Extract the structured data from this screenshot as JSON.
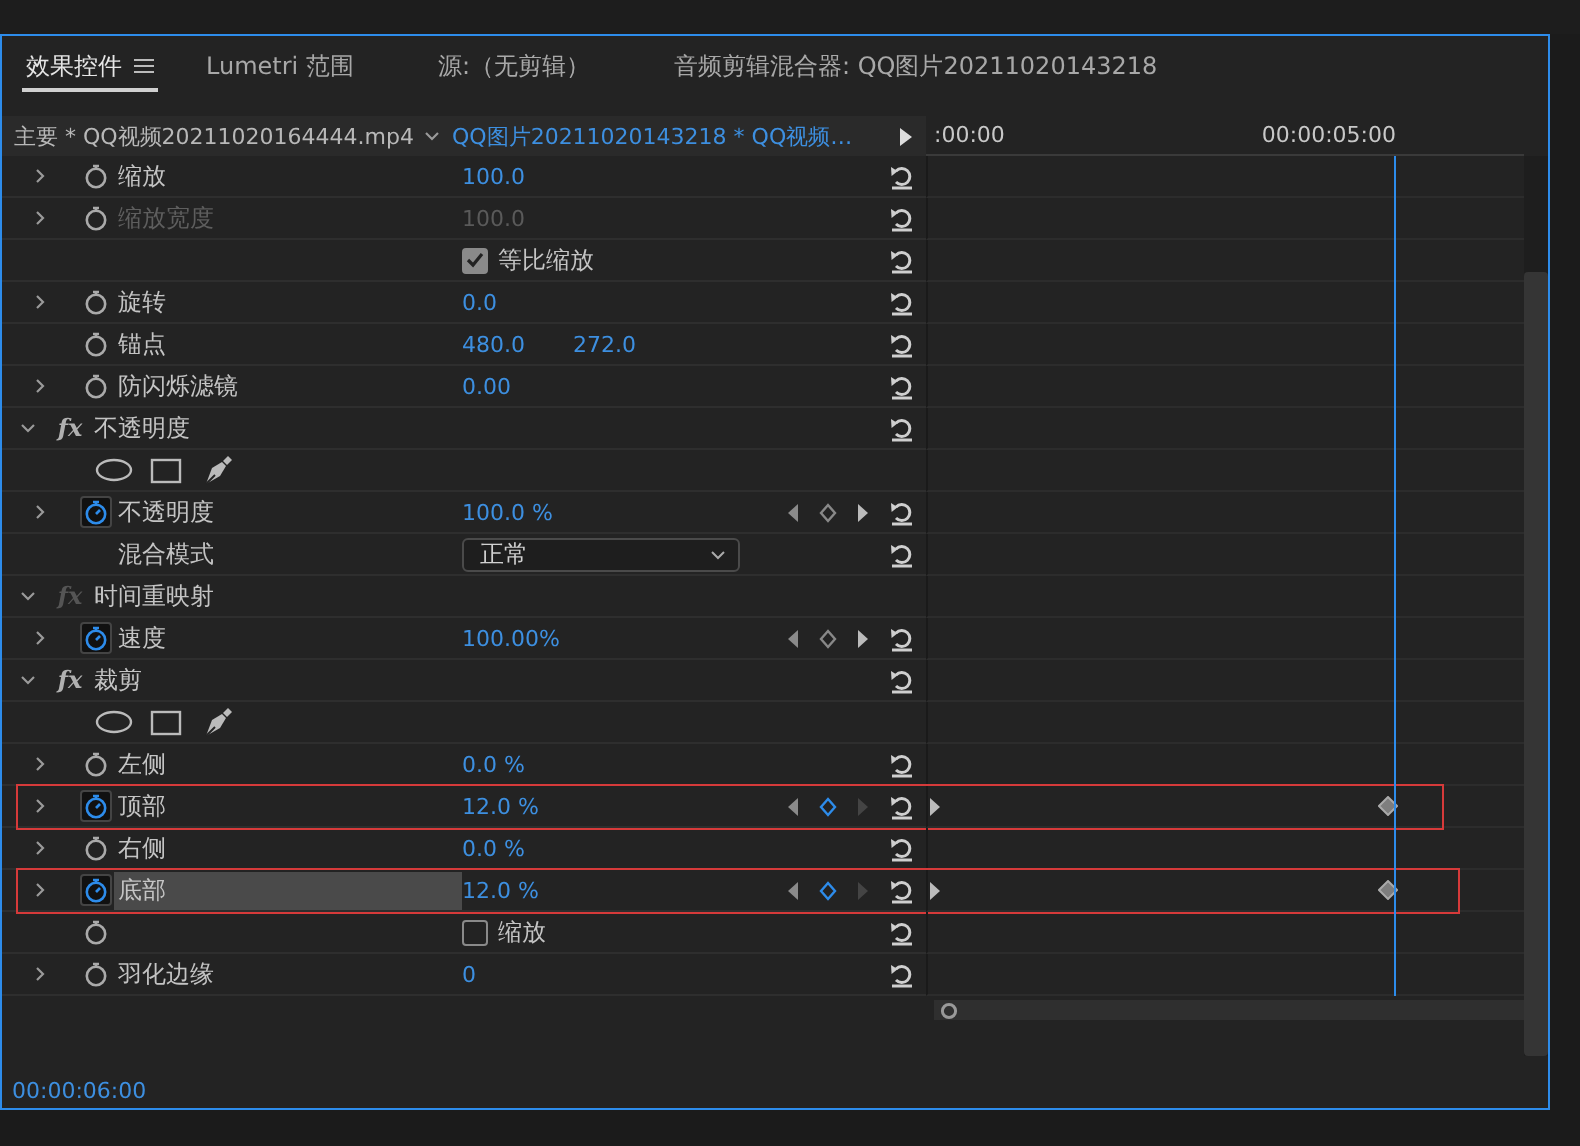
{
  "tabs": [
    {
      "label": "效果控件",
      "selected": true,
      "menu": true
    },
    {
      "label": "Lumetri 范围",
      "selected": false,
      "menu": false
    },
    {
      "label": "源:（无剪辑）",
      "selected": false,
      "menu": false
    },
    {
      "label": "音频剪辑混合器: QQ图片20211020143218",
      "selected": false,
      "menu": false
    }
  ],
  "header": {
    "master_clip": "主要 * QQ视频20211020164444.mp4",
    "sequence_clip": "QQ图片20211020143218  * QQ视频…",
    "ruler_start": ":00:00",
    "ruler_mark": "00:00:05:00"
  },
  "rows": [
    {
      "kind": "property",
      "label": "缩放",
      "value": "100.0",
      "expandable": true,
      "animated": false,
      "disabled": false,
      "keyframe_nav": false,
      "outlined": false,
      "selected": false,
      "timeline_keys": false
    },
    {
      "kind": "property",
      "label": "缩放宽度",
      "value": "100.0",
      "expandable": true,
      "animated": false,
      "disabled": true,
      "keyframe_nav": false,
      "outlined": false,
      "selected": false,
      "timeline_keys": false
    },
    {
      "kind": "checkbox",
      "label": "等比缩放",
      "checked": true,
      "stopwatch": false
    },
    {
      "kind": "property",
      "label": "旋转",
      "value": "0.0",
      "expandable": true,
      "animated": false,
      "disabled": false,
      "keyframe_nav": false,
      "outlined": false,
      "selected": false,
      "timeline_keys": false
    },
    {
      "kind": "property",
      "label": "锚点",
      "value": "480.0",
      "value2": "272.0",
      "expandable": false,
      "animated": false,
      "disabled": false,
      "keyframe_nav": false,
      "outlined": false,
      "selected": false,
      "timeline_keys": false
    },
    {
      "kind": "property",
      "label": "防闪烁滤镜",
      "value": "0.00",
      "expandable": true,
      "animated": false,
      "disabled": false,
      "keyframe_nav": false,
      "outlined": false,
      "selected": false,
      "timeline_keys": false
    },
    {
      "kind": "effect",
      "badge": "fx",
      "label": "不透明度",
      "fx_enabled": true,
      "reset": true
    },
    {
      "kind": "shapes"
    },
    {
      "kind": "property",
      "label": "不透明度",
      "value": "100.0 %",
      "expandable": true,
      "animated": true,
      "disabled": false,
      "keyframe_nav": true,
      "outlined": false,
      "selected": false,
      "timeline_keys": false
    },
    {
      "kind": "dropdown",
      "label": "混合模式",
      "value": "正常"
    },
    {
      "kind": "effect",
      "badge": "fx",
      "label": "时间重映射",
      "fx_enabled": false,
      "reset": false
    },
    {
      "kind": "property",
      "label": "速度",
      "value": "100.00%",
      "expandable": true,
      "animated": true,
      "disabled": false,
      "keyframe_nav": true,
      "outlined": false,
      "selected": false,
      "timeline_keys": false
    },
    {
      "kind": "effect",
      "badge": "fx",
      "label": "裁剪",
      "fx_enabled": true,
      "reset": true
    },
    {
      "kind": "shapes"
    },
    {
      "kind": "property",
      "label": "左侧",
      "value": "0.0 %",
      "expandable": true,
      "animated": false,
      "disabled": false,
      "keyframe_nav": false,
      "outlined": false,
      "selected": false,
      "timeline_keys": false
    },
    {
      "kind": "property",
      "label": "顶部",
      "value": "12.0 %",
      "expandable": true,
      "animated": true,
      "disabled": false,
      "keyframe_nav": true,
      "outlined": true,
      "selected": false,
      "timeline_keys": true
    },
    {
      "kind": "property",
      "label": "右侧",
      "value": "0.0 %",
      "expandable": true,
      "animated": false,
      "disabled": false,
      "keyframe_nav": false,
      "outlined": false,
      "selected": false,
      "timeline_keys": false
    },
    {
      "kind": "property",
      "label": "底部",
      "value": "12.0 %",
      "expandable": true,
      "animated": true,
      "disabled": false,
      "keyframe_nav": true,
      "outlined": true,
      "selected": true,
      "timeline_keys": true
    },
    {
      "kind": "checkbox",
      "label": "缩放",
      "checked": false,
      "stopwatch": true
    },
    {
      "kind": "property",
      "label": "羽化边缘",
      "value": "0",
      "expandable": true,
      "animated": false,
      "disabled": false,
      "keyframe_nav": false,
      "outlined": false,
      "selected": false,
      "timeline_keys": false
    }
  ],
  "timecode": "00:00:06:00"
}
